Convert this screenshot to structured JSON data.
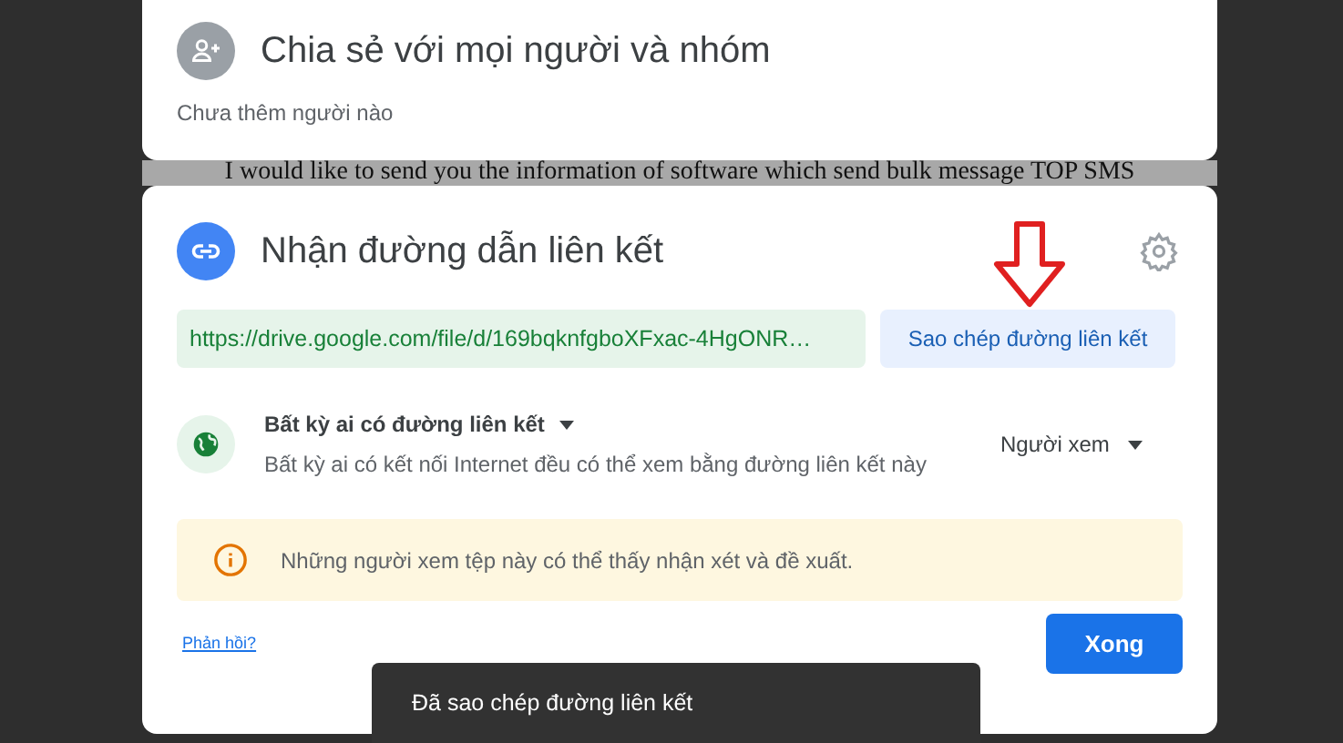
{
  "share_section": {
    "title": "Chia sẻ với mọi người và nhóm",
    "subtitle": "Chưa thêm người nào"
  },
  "background_text": "I would like to send you the information of software which send bulk message TOP SMS",
  "link_section": {
    "title": "Nhận đường dẫn liên kết",
    "url": "https://drive.google.com/file/d/169bqknfgboXFxac-4HgONR…",
    "copy_button": "Sao chép đường liên kết",
    "access": {
      "scope": "Bất kỳ ai có đường liên kết",
      "description": "Bất kỳ ai có kết nối Internet đều có thể xem bằng đường liên kết này",
      "role": "Người xem"
    },
    "notice": "Những người xem tệp này có thể thấy nhận xét và đề xuất."
  },
  "footer": {
    "feedback_link": "Phản hồi?",
    "done_button": "Xong"
  },
  "toast": "Đã sao chép đường liên kết"
}
